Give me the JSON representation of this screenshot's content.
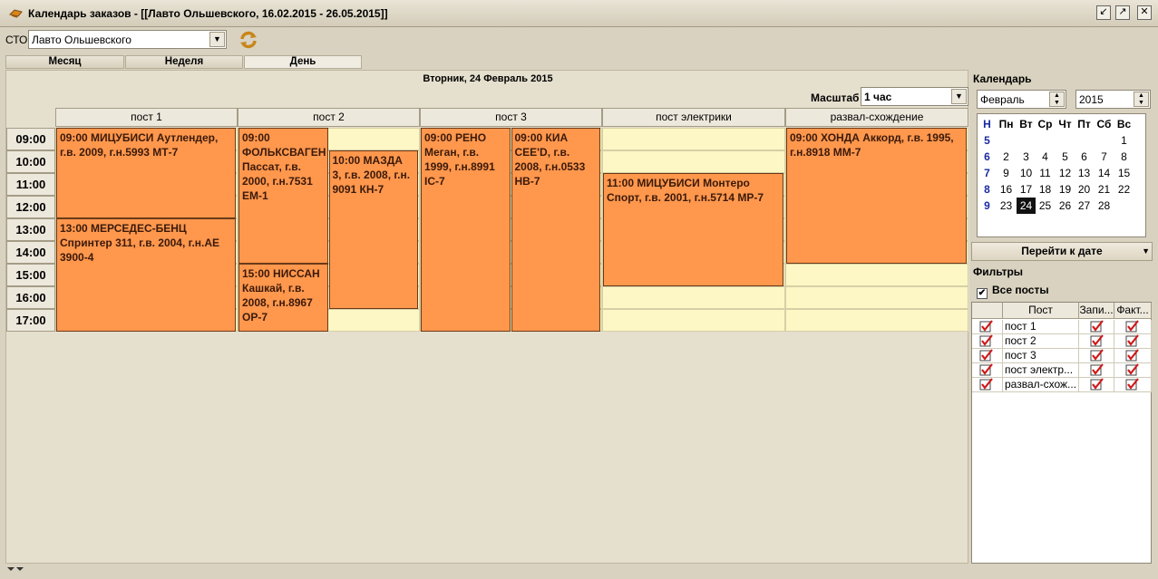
{
  "window": {
    "title": "Календарь заказов - [[Лавто Ольшевского, 16.02.2015 - 26.05.2015]]",
    "buttons": [
      "restore",
      "minimize",
      "close"
    ]
  },
  "toolbar": {
    "sto_label": "СТО",
    "sto_value": "Лавто Ольшевского"
  },
  "tabs": [
    {
      "label": "Месяц",
      "active": false
    },
    {
      "label": "Неделя",
      "active": false
    },
    {
      "label": "День",
      "active": true
    }
  ],
  "schedule": {
    "date_title": "Вторник, 24 Февраль 2015",
    "scale_label": "Масштаб",
    "scale_value": "1 час",
    "posts": [
      "пост 1",
      "пост 2",
      "пост 3",
      "пост  электрики",
      "развал-схождение"
    ],
    "times": [
      "09:00",
      "10:00",
      "11:00",
      "12:00",
      "13:00",
      "14:00",
      "15:00",
      "16:00",
      "17:00"
    ],
    "events": [
      {
        "post": 0,
        "sub": 0,
        "subs": 1,
        "start": 0,
        "dur": 4,
        "text": "09:00 МИЦУБИСИ Аутлендер, г.в. 2009, г.н.5993 МТ-7"
      },
      {
        "post": 0,
        "sub": 0,
        "subs": 1,
        "start": 4,
        "dur": 5,
        "text": "13:00 МЕРСЕДЕС-БЕНЦ Спринтер 311, г.в. 2004, г.н.АЕ 3900-4"
      },
      {
        "post": 1,
        "sub": 0,
        "subs": 2,
        "start": 0,
        "dur": 6,
        "text": "09:00 ФОЛЬКСВАГЕН Пассат, г.в. 2000, г.н.7531 ЕМ-1"
      },
      {
        "post": 1,
        "sub": 0,
        "subs": 2,
        "start": 6,
        "dur": 3,
        "text": "15:00 НИССАН Кашкай, г.в. 2008, г.н.8967 ОР-7"
      },
      {
        "post": 1,
        "sub": 1,
        "subs": 2,
        "start": 1,
        "dur": 7,
        "text": "10:00 МАЗДА 3, г.в. 2008, г.н. 9091 КН-7"
      },
      {
        "post": 2,
        "sub": 0,
        "subs": 2,
        "start": 0,
        "dur": 9,
        "text": "09:00 РЕНО Меган, г.в. 1999, г.н.8991 IC-7"
      },
      {
        "post": 2,
        "sub": 1,
        "subs": 2,
        "start": 0,
        "dur": 9,
        "text": "09:00 КИА CEE'D, г.в. 2008, г.н.0533 НВ-7"
      },
      {
        "post": 3,
        "sub": 0,
        "subs": 1,
        "start": 2,
        "dur": 5,
        "text": "11:00 МИЦУБИСИ Монтеро Спорт, г.в. 2001, г.н.5714 МР-7"
      },
      {
        "post": 4,
        "sub": 0,
        "subs": 1,
        "start": 0,
        "dur": 6,
        "text": "09:00 ХОНДА Аккорд, г.в. 1995, г.н.8918 ММ-7"
      }
    ]
  },
  "calendar": {
    "title": "Календарь",
    "month": "Февраль",
    "year": "2015",
    "headers": [
      "Н",
      "Пн",
      "Вт",
      "Ср",
      "Чт",
      "Пт",
      "Сб",
      "Вс"
    ],
    "weeks": [
      [
        "5",
        "",
        "",
        "",
        "",
        "",
        "",
        "1"
      ],
      [
        "6",
        "2",
        "3",
        "4",
        "5",
        "6",
        "7",
        "8"
      ],
      [
        "7",
        "9",
        "10",
        "11",
        "12",
        "13",
        "14",
        "15"
      ],
      [
        "8",
        "16",
        "17",
        "18",
        "19",
        "20",
        "21",
        "22"
      ],
      [
        "9",
        "23",
        "24",
        "25",
        "26",
        "27",
        "28",
        ""
      ]
    ],
    "selected_day": "24",
    "goto_label": "Перейти к дате"
  },
  "filters": {
    "title": "Фильтры",
    "all_posts_label": "Все посты",
    "all_posts_checked": true,
    "columns": [
      "Пост",
      "Запи...",
      "Факт..."
    ],
    "rows": [
      {
        "name": "пост 1",
        "checked": true,
        "rec": true,
        "fact": true
      },
      {
        "name": "пост 2",
        "checked": true,
        "rec": true,
        "fact": true
      },
      {
        "name": "пост 3",
        "checked": true,
        "rec": true,
        "fact": true
      },
      {
        "name": "пост  электр...",
        "checked": true,
        "rec": true,
        "fact": true
      },
      {
        "name": "развал-схож...",
        "checked": true,
        "rec": true,
        "fact": true
      }
    ]
  }
}
